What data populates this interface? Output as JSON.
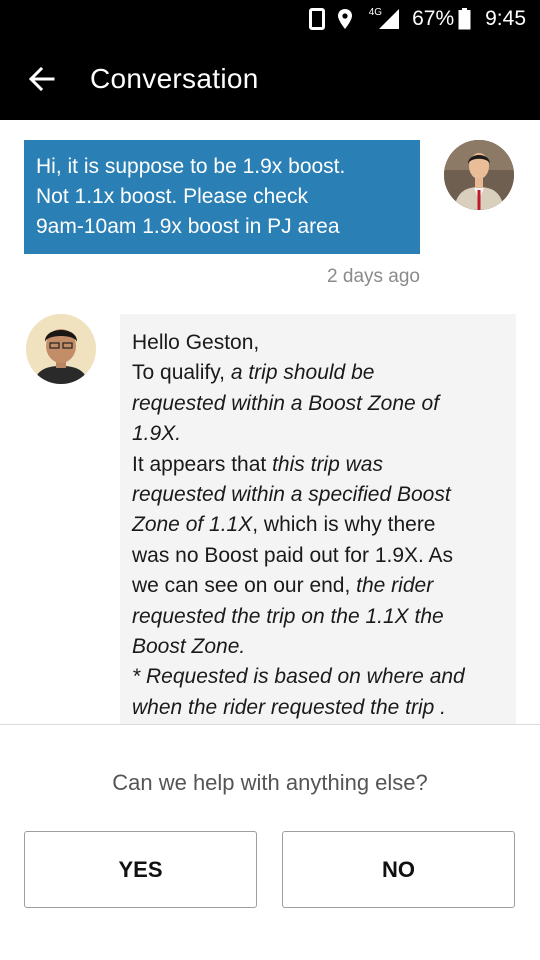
{
  "status_bar": {
    "network": "4G",
    "battery": "67%",
    "time": "9:45",
    "icons": [
      "phone-outline-icon",
      "location-pin-icon",
      "signal-icon",
      "battery-icon"
    ]
  },
  "header": {
    "title": "Conversation",
    "back_icon": "back-arrow-icon"
  },
  "messages": [
    {
      "sender": "user",
      "lines": [
        "Hi, it is suppose to be 1.9x boost.",
        "Not 1.1x boost. Please check",
        "9am-10am 1.9x boost in PJ area"
      ],
      "timestamp": "2 days ago",
      "color": "#2a7fb5"
    },
    {
      "sender": "support",
      "lines": {
        "l1": "Hello Geston,",
        "l2a": "To qualify, ",
        "l2b": "a trip should be",
        "l3": "requested within a Boost Zone of",
        "l4": "1.9X.",
        "l5a": "It appears that ",
        "l5b": "this trip was",
        "l6": "requested within a specified Boost",
        "l7a": "Zone of 1.1X",
        "l7b": ", which is why there",
        "l8": "was no Boost paid out for 1.9X. As",
        "l9a": "we can see on our end, ",
        "l9b": "the rider",
        "l10": "requested the trip on the 1.1X the",
        "l11": "Boost Zone.",
        "l12": "* Requested is based on where and",
        "l13": "when the rider requested the trip ."
      }
    }
  ],
  "footer": {
    "prompt": "Can we help with anything else?",
    "yes_label": "YES",
    "no_label": "NO"
  }
}
